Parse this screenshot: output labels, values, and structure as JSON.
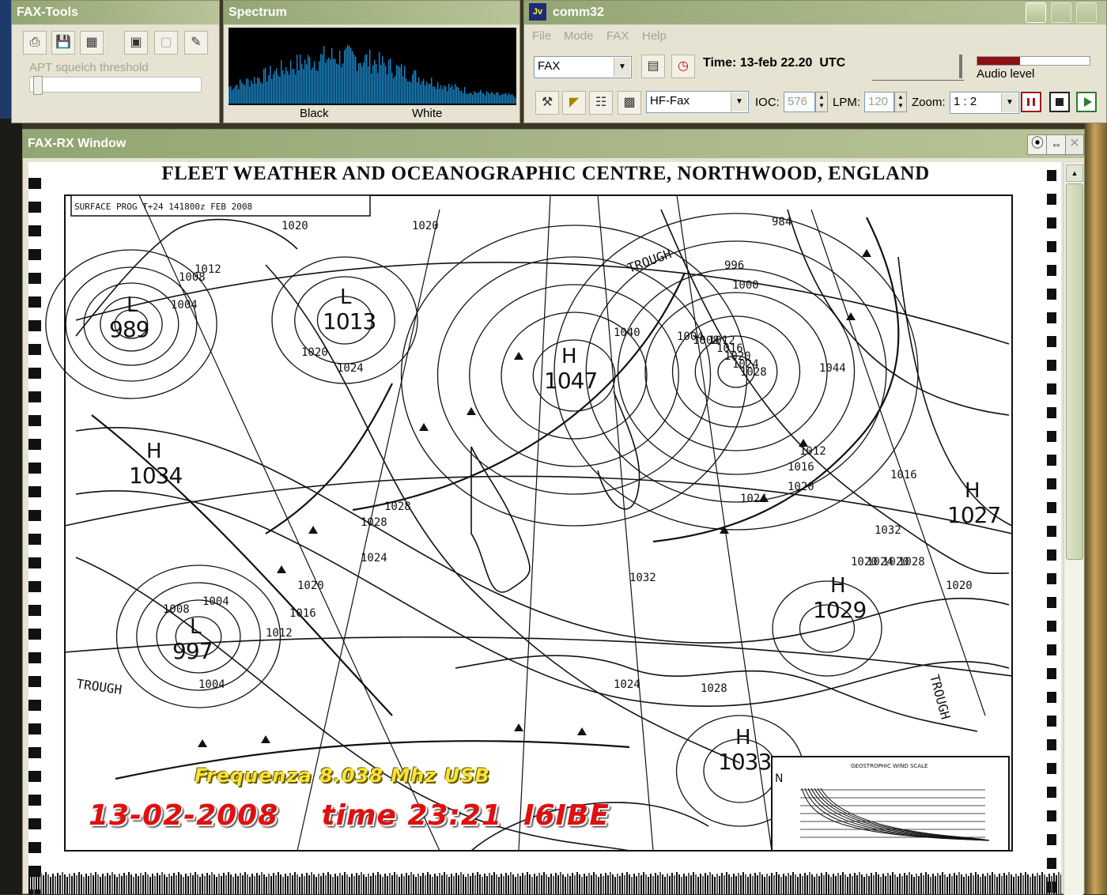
{
  "fax_tools": {
    "title": "FAX-Tools",
    "squelch_label": "APT squelch threshold",
    "tool_icons": [
      "printer-icon",
      "save-icon",
      "calendar-icon",
      "film-icon",
      "image-icon",
      "brush-icon"
    ]
  },
  "spectrum": {
    "title": "Spectrum",
    "black_label": "Black",
    "white_label": "White"
  },
  "comm32": {
    "title": "comm32",
    "app_icon_text": "Jv",
    "menu": [
      "File",
      "Mode",
      "FAX",
      "Help"
    ],
    "mode_value": "FAX",
    "time_text": "Time: 13-feb 22.20  UTC",
    "audio_label": "Audio level",
    "audio_level": 0.38,
    "format_value": "HF-Fax",
    "ioc_label": "IOC:",
    "ioc_value": "576",
    "lpm_label": "LPM:",
    "lpm_value": "120",
    "zoom_label": "Zoom:",
    "zoom_value": "1 : 2"
  },
  "fax_rx": {
    "title": "FAX-RX Window",
    "header": "FLEET WEATHER AND OCEANOGRAPHIC CENTRE, NORTHWOOD, ENGLAND",
    "subtitle": "SURFACE PROG T+24 141800z FEB 2008",
    "centers": [
      {
        "type": "L",
        "value": "989"
      },
      {
        "type": "L",
        "value": "1013"
      },
      {
        "type": "H",
        "value": "1047"
      },
      {
        "type": "H",
        "value": "1034"
      },
      {
        "type": "L",
        "value": "997"
      },
      {
        "type": "H",
        "value": "1027"
      },
      {
        "type": "H",
        "value": "1029"
      },
      {
        "type": "H",
        "value": "1033"
      }
    ],
    "contour_labels": [
      "1020",
      "1020",
      "1012",
      "1008",
      "1004",
      "1020",
      "1024",
      "1028",
      "1032",
      "1024",
      "1020",
      "1016",
      "1012",
      "1008",
      "1004",
      "1004",
      "1004",
      "1008",
      "1012",
      "1016",
      "1020",
      "1024",
      "1028",
      "1012",
      "1016",
      "1020",
      "1024",
      "1028",
      "1032",
      "1016",
      "1020",
      "1024",
      "1020",
      "1028",
      "1024",
      "1020",
      "1028",
      "984",
      "996",
      "1000",
      "1040",
      "1044"
    ],
    "trough_labels": [
      "TROUGH",
      "TROUGH",
      "TROUGH"
    ],
    "scale_title": "GEOSTROPHIC WIND SCALE",
    "scale_n": "N",
    "overlay_freq": "Frequenza 8.038 Mhz USB",
    "overlay_date": "13-02-2008    time 23:21  I6IBE"
  }
}
